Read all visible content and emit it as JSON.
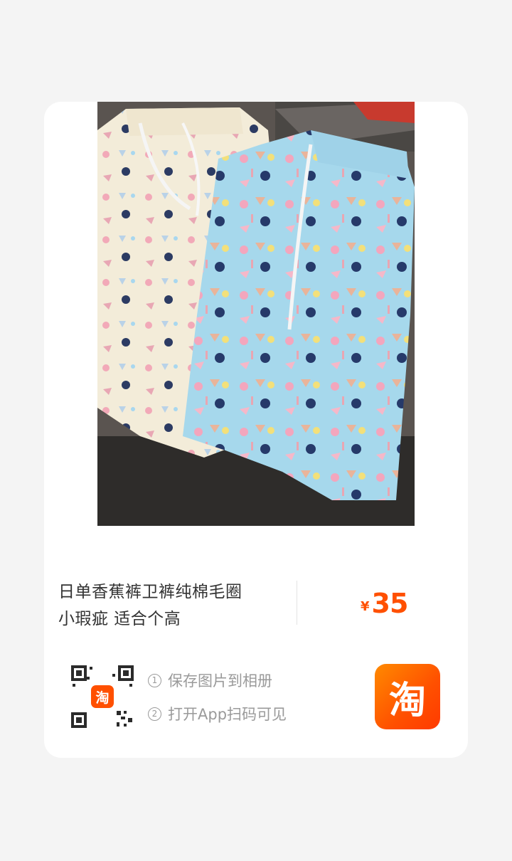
{
  "product": {
    "title_line1": "日单香蕉裤卫裤纯棉毛圈",
    "title_line2": "小瑕疵 适合个高",
    "currency": "¥",
    "price": "35"
  },
  "share": {
    "qr_badge": "淘",
    "step1_num": "1",
    "step1_text": "保存图片到相册",
    "step2_num": "2",
    "step2_text": "打开App扫码可见"
  },
  "brand": {
    "logo_char": "淘",
    "accent_color": "#ff5000"
  }
}
